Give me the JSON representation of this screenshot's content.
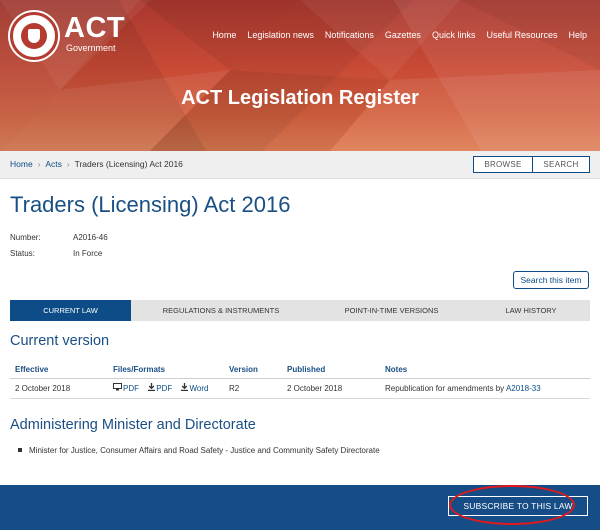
{
  "header": {
    "brand_name": "ACT",
    "brand_sub": "Government",
    "nav": [
      "Home",
      "Legislation news",
      "Notifications",
      "Gazettes",
      "Quick links",
      "Useful Resources",
      "Help"
    ],
    "site_title": "ACT Legislation Register"
  },
  "breadcrumb": {
    "items": [
      "Home",
      "Acts",
      "Traders (Licensing) Act 2016"
    ],
    "browse_label": "BROWSE",
    "search_label": "SEARCH"
  },
  "law": {
    "title": "Traders (Licensing) Act 2016",
    "number_label": "Number:",
    "number_value": "A2016-46",
    "status_label": "Status:",
    "status_value": "In Force",
    "search_item_label": "Search this item"
  },
  "tabs": [
    {
      "label": "CURRENT LAW",
      "active": true
    },
    {
      "label": "REGULATIONS & INSTRUMENTS",
      "active": false
    },
    {
      "label": "POINT-IN-TIME VERSIONS",
      "active": false
    },
    {
      "label": "LAW HISTORY",
      "active": false
    }
  ],
  "current_version": {
    "heading": "Current version",
    "columns": [
      "Effective",
      "Files/Formats",
      "Version",
      "Published",
      "Notes"
    ],
    "row": {
      "effective": "2 October 2018",
      "formats": [
        {
          "icon": "monitor-icon",
          "label": "PDF"
        },
        {
          "icon": "download-icon",
          "label": "PDF"
        },
        {
          "icon": "download-icon",
          "label": "Word"
        }
      ],
      "version": "R2",
      "published": "2 October 2018",
      "notes_text": "Republication for amendments by ",
      "notes_link": "A2018-33"
    }
  },
  "admin": {
    "heading": "Administering Minister and Directorate",
    "items": [
      "Minister for Justice, Consumer Affairs and Road Safety - Justice and Community Safety Directorate"
    ]
  },
  "footer": {
    "subscribe_label": "SUBSCRIBE TO THIS LAW"
  },
  "colors": {
    "brand_blue": "#0d4c86",
    "heading_blue": "#1a4f85",
    "footer_blue": "#174d86",
    "banner_red": "#c84a35",
    "highlight_red": "#e3181c"
  }
}
